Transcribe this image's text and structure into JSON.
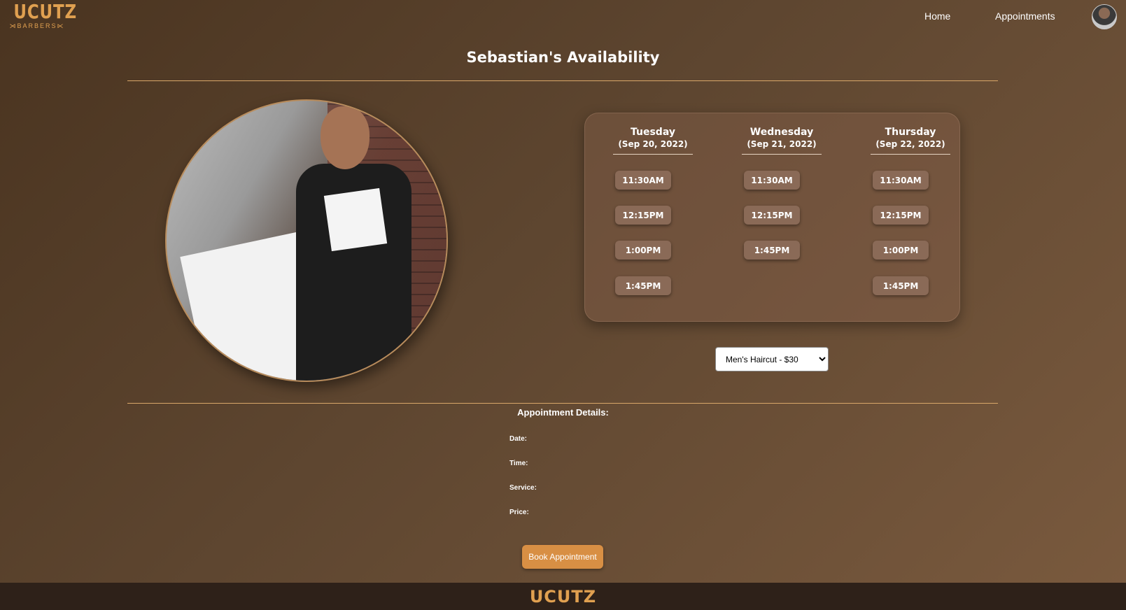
{
  "header": {
    "logo_word": "UCUTZ",
    "logo_sub": "⋊BARBERS⋉",
    "nav_home": "Home",
    "nav_appointments": "Appointments"
  },
  "page_title": "Sebastian's Availability",
  "schedule": {
    "days": [
      {
        "name": "Tuesday",
        "date": "(Sep 20, 2022)",
        "slots": [
          "11:30AM",
          "12:15PM",
          "1:00PM",
          "1:45PM"
        ]
      },
      {
        "name": "Wednesday",
        "date": "(Sep 21, 2022)",
        "slots": [
          "11:30AM",
          "12:15PM",
          "1:45PM"
        ]
      },
      {
        "name": "Thursday",
        "date": "(Sep 22, 2022)",
        "slots": [
          "11:30AM",
          "12:15PM",
          "1:00PM",
          "1:45PM"
        ]
      }
    ]
  },
  "service": {
    "selected": "Men's Haircut - $30"
  },
  "details": {
    "title": "Appointment Details:",
    "date_label": "Date:",
    "time_label": "Time:",
    "service_label": "Service:",
    "price_label": "Price:",
    "book_label": "Book Appointment"
  },
  "footer": {
    "logo_word": "UCUTZ"
  },
  "colors": {
    "accent": "#d88f44",
    "rule": "#d9a769",
    "slot_bg": "#8a6a57"
  }
}
